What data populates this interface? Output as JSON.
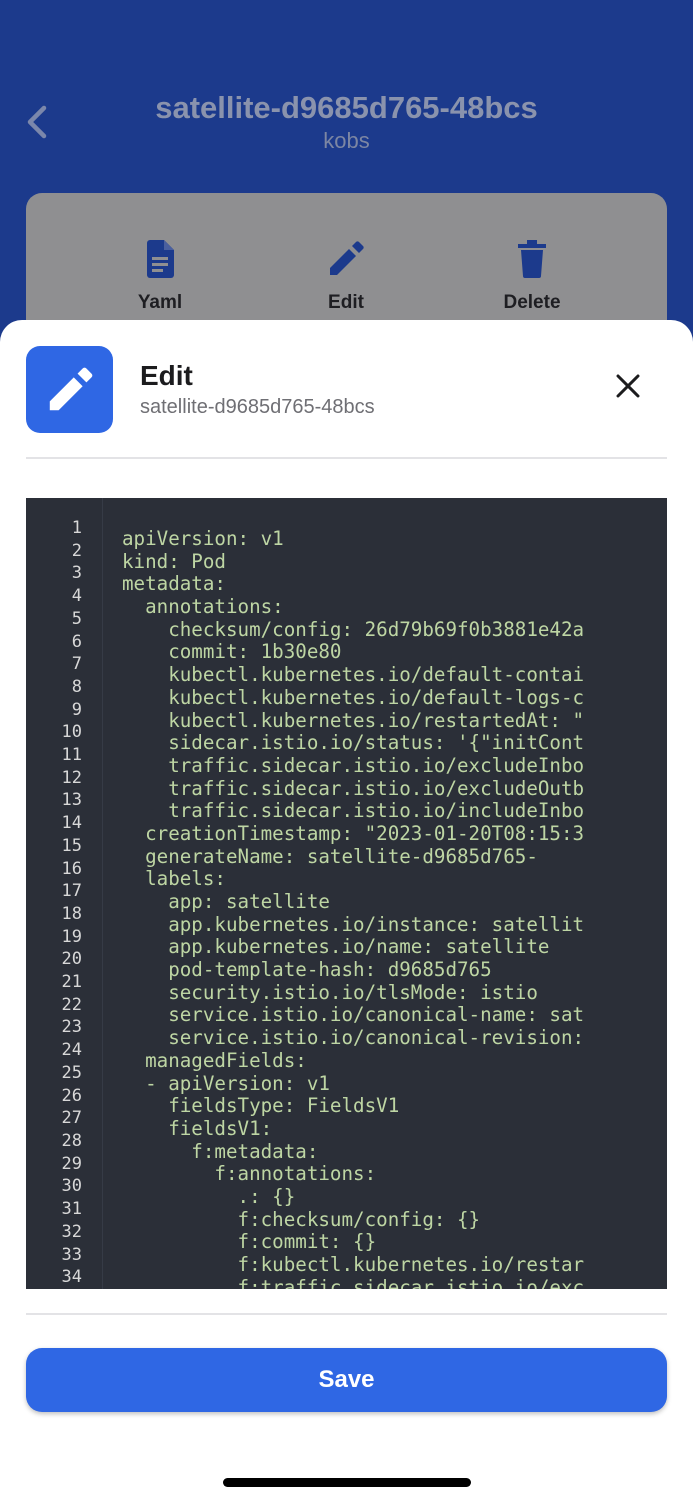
{
  "background": {
    "title": "satellite-d9685d765-48bcs",
    "subtitle": "kobs",
    "actions": [
      {
        "label": "Yaml",
        "icon": "document-icon"
      },
      {
        "label": "Edit",
        "icon": "pencil-icon"
      },
      {
        "label": "Delete",
        "icon": "trash-icon"
      }
    ]
  },
  "sheet": {
    "title": "Edit",
    "subtitle": "satellite-d9685d765-48bcs",
    "icon": "pencil-icon",
    "save_label": "Save"
  },
  "colors": {
    "primary": "#2f67e4",
    "header_bg": "#1c3a8c",
    "editor_bg": "#2b2f38",
    "code_text": "#bed6a4"
  },
  "editor": {
    "line_numbers": "1\n2\n3\n4\n5\n6\n7\n8\n9\n10\n11\n12\n13\n14\n15\n16\n17\n18\n19\n20\n21\n22\n23\n24\n25\n26\n27\n28\n29\n30\n31\n32\n33\n34",
    "lines": [
      "apiVersion: v1",
      "kind: Pod",
      "metadata:",
      "  annotations:",
      "    checksum/config: 26d79b69f0b3881e42a",
      "    commit: 1b30e80",
      "    kubectl.kubernetes.io/default-contai",
      "    kubectl.kubernetes.io/default-logs-c",
      "    kubectl.kubernetes.io/restartedAt: \"",
      "    sidecar.istio.io/status: '{\"initCont",
      "    traffic.sidecar.istio.io/excludeInbo",
      "    traffic.sidecar.istio.io/excludeOutb",
      "    traffic.sidecar.istio.io/includeInbo",
      "  creationTimestamp: \"2023-01-20T08:15:3",
      "  generateName: satellite-d9685d765-",
      "  labels:",
      "    app: satellite",
      "    app.kubernetes.io/instance: satellit",
      "    app.kubernetes.io/name: satellite",
      "    pod-template-hash: d9685d765",
      "    security.istio.io/tlsMode: istio",
      "    service.istio.io/canonical-name: sat",
      "    service.istio.io/canonical-revision:",
      "  managedFields:",
      "  - apiVersion: v1",
      "    fieldsType: FieldsV1",
      "    fieldsV1:",
      "      f:metadata:",
      "        f:annotations:",
      "          .: {}",
      "          f:checksum/config: {}",
      "          f:commit: {}",
      "          f:kubectl.kubernetes.io/restar",
      "          f:traffic.sidecar.istio.io/exc"
    ]
  }
}
